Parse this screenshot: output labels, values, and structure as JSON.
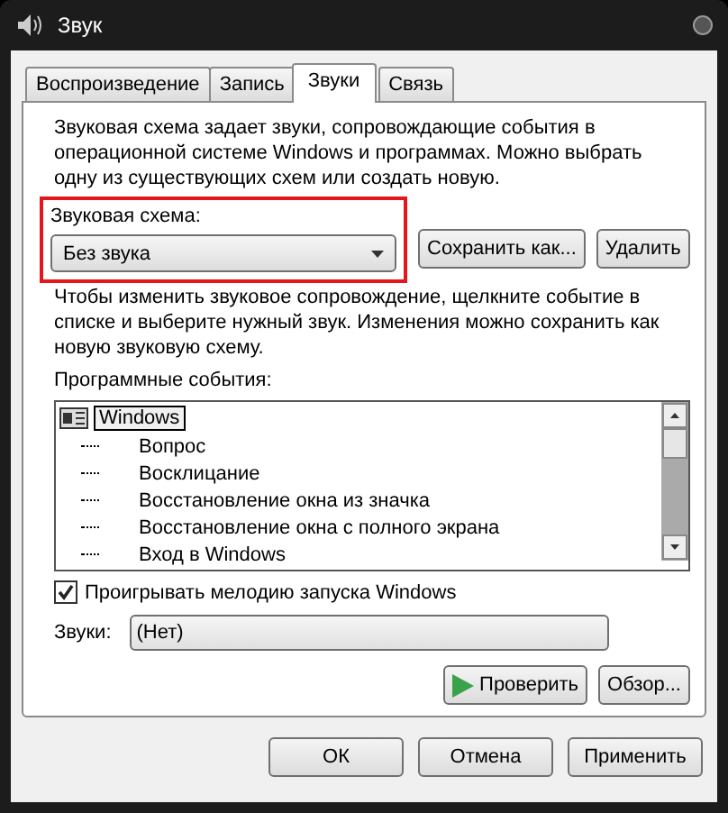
{
  "window": {
    "title": "Звук"
  },
  "tabs": [
    {
      "label": "Воспроизведение",
      "selected": false
    },
    {
      "label": "Запись",
      "selected": false
    },
    {
      "label": "Звуки",
      "selected": true
    },
    {
      "label": "Связь",
      "selected": false
    }
  ],
  "description": "Звуковая схема задает звуки, сопровождающие события в операционной системе Windows и программах. Можно выбрать одну из существующих схем или создать новую.",
  "scheme": {
    "label": "Звуковая схема:",
    "value": "Без звука",
    "highlighted": true,
    "buttons": [
      "Сохранить как...",
      "Удалить"
    ]
  },
  "hint": "Чтобы изменить звуковое сопровождение, щелкните событие в списке и выберите нужный звук. Изменения можно сохранить как новую звуковую схему.",
  "events": {
    "label": "Программные события:",
    "items": [
      {
        "label": "Windows",
        "selected": true,
        "children": [
          {
            "label": "Вопрос",
            "selected": false
          },
          {
            "label": "Восклицание",
            "selected": false
          },
          {
            "label": "Восстановление окна из значка",
            "selected": false
          },
          {
            "label": "Восстановление окна с полного экрана",
            "selected": false
          },
          {
            "label": "Вход в Windows",
            "selected": false
          }
        ]
      }
    ]
  },
  "startup": {
    "label": "Проигрывать мелодию запуска Windows",
    "checked": true
  },
  "sounds": {
    "label": "Звуки:",
    "value": "(Нет)"
  },
  "sound_buttons": [
    {
      "label": "Проверить",
      "kind": "play"
    },
    {
      "label": "Обзор...",
      "kind": "plain"
    }
  ],
  "buttons": [
    "ОК",
    "Отмена",
    "Применить"
  ]
}
